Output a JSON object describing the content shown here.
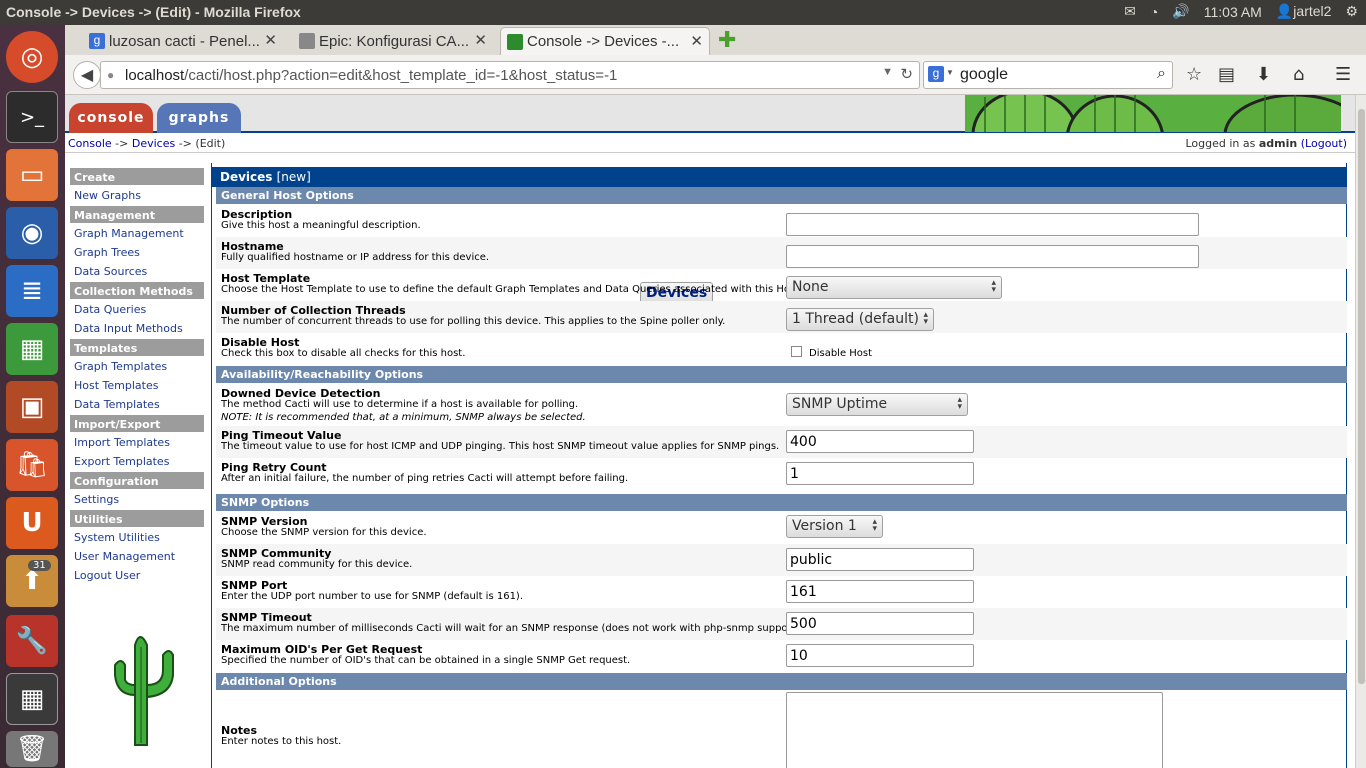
{
  "window_title": "Console -> Devices -> (Edit) - Mozilla Firefox",
  "system": {
    "time": "11:03 AM",
    "user": "jartel2"
  },
  "launcher": {
    "badge": "31"
  },
  "tabs": [
    {
      "label": "luzosan cacti - Penel...",
      "close": "✕"
    },
    {
      "label": "Epic: Konfigurasi CA...",
      "close": "✕"
    },
    {
      "label": "Console -> Devices -...",
      "close": "✕"
    }
  ],
  "url": {
    "host": "localhost",
    "path": "/cacti/host.php?action=edit&host_template_id=-1&host_status=-1"
  },
  "search": {
    "value": "google"
  },
  "cacti": {
    "tab_console": "console",
    "tab_graphs": "graphs",
    "breadcrumb": {
      "console": "Console",
      "sep1": " -> ",
      "devices": "Devices",
      "sep2": " -> ",
      "edit": "(Edit)"
    },
    "login": {
      "prefix": "Logged in as ",
      "user": "admin",
      "logout": "(Logout)"
    }
  },
  "menu": [
    {
      "type": "head",
      "label": "Create"
    },
    {
      "type": "item",
      "label": "New Graphs"
    },
    {
      "type": "head",
      "label": "Management"
    },
    {
      "type": "item",
      "label": "Graph Management"
    },
    {
      "type": "item",
      "label": "Graph Trees"
    },
    {
      "type": "item",
      "label": "Data Sources"
    },
    {
      "type": "item",
      "label": "Devices",
      "selected": true
    },
    {
      "type": "head",
      "label": "Collection Methods"
    },
    {
      "type": "item",
      "label": "Data Queries"
    },
    {
      "type": "item",
      "label": "Data Input Methods"
    },
    {
      "type": "head",
      "label": "Templates"
    },
    {
      "type": "item",
      "label": "Graph Templates"
    },
    {
      "type": "item",
      "label": "Host Templates"
    },
    {
      "type": "item",
      "label": "Data Templates"
    },
    {
      "type": "head",
      "label": "Import/Export"
    },
    {
      "type": "item",
      "label": "Import Templates"
    },
    {
      "type": "item",
      "label": "Export Templates"
    },
    {
      "type": "head",
      "label": "Configuration"
    },
    {
      "type": "item",
      "label": "Settings"
    },
    {
      "type": "head",
      "label": "Utilities"
    },
    {
      "type": "item",
      "label": "System Utilities"
    },
    {
      "type": "item",
      "label": "User Management"
    },
    {
      "type": "item",
      "label": "Logout User"
    }
  ],
  "form": {
    "title": "Devices",
    "title_suffix": "[new]",
    "sections": {
      "general": "General Host Options",
      "availability": "Availability/Reachability Options",
      "snmp": "SNMP Options",
      "additional": "Additional Options"
    },
    "description": {
      "label": "Description",
      "desc": "Give this host a meaningful description.",
      "value": ""
    },
    "hostname": {
      "label": "Hostname",
      "desc": "Fully qualified hostname or IP address for this device.",
      "value": ""
    },
    "host_template": {
      "label": "Host Template",
      "desc": "Choose the Host Template to use to define the default Graph Templates and Data Queries associated with this Host.",
      "value": "None"
    },
    "threads": {
      "label": "Number of Collection Threads",
      "desc": "The number of concurrent threads to use for polling this device. This applies to the Spine poller only.",
      "value": "1 Thread (default)"
    },
    "disable": {
      "label": "Disable Host",
      "desc": "Check this box to disable all checks for this host.",
      "checkbox_label": "Disable Host"
    },
    "downed": {
      "label": "Downed Device Detection",
      "desc": "The method Cacti will use to determine if a host is available for polling.",
      "note": "NOTE: It is recommended that, at a minimum, SNMP always be selected.",
      "value": "SNMP Uptime"
    },
    "ping_timeout": {
      "label": "Ping Timeout Value",
      "desc": "The timeout value to use for host ICMP and UDP pinging. This host SNMP timeout value applies for SNMP pings.",
      "value": "400"
    },
    "ping_retry": {
      "label": "Ping Retry Count",
      "desc": "After an initial failure, the number of ping retries Cacti will attempt before failing.",
      "value": "1"
    },
    "snmp_version": {
      "label": "SNMP Version",
      "desc": "Choose the SNMP version for this device.",
      "value": "Version 1"
    },
    "snmp_community": {
      "label": "SNMP Community",
      "desc": "SNMP read community for this device.",
      "value": "public"
    },
    "snmp_port": {
      "label": "SNMP Port",
      "desc": "Enter the UDP port number to use for SNMP (default is 161).",
      "value": "161"
    },
    "snmp_timeout": {
      "label": "SNMP Timeout",
      "desc": "The maximum number of milliseconds Cacti will wait for an SNMP response (does not work with php-snmp support).",
      "value": "500"
    },
    "max_oids": {
      "label": "Maximum OID's Per Get Request",
      "desc": "Specified the number of OID's that can be obtained in a single SNMP Get request.",
      "value": "10"
    },
    "notes": {
      "label": "Notes",
      "desc": "Enter notes to this host.",
      "value": ""
    }
  }
}
